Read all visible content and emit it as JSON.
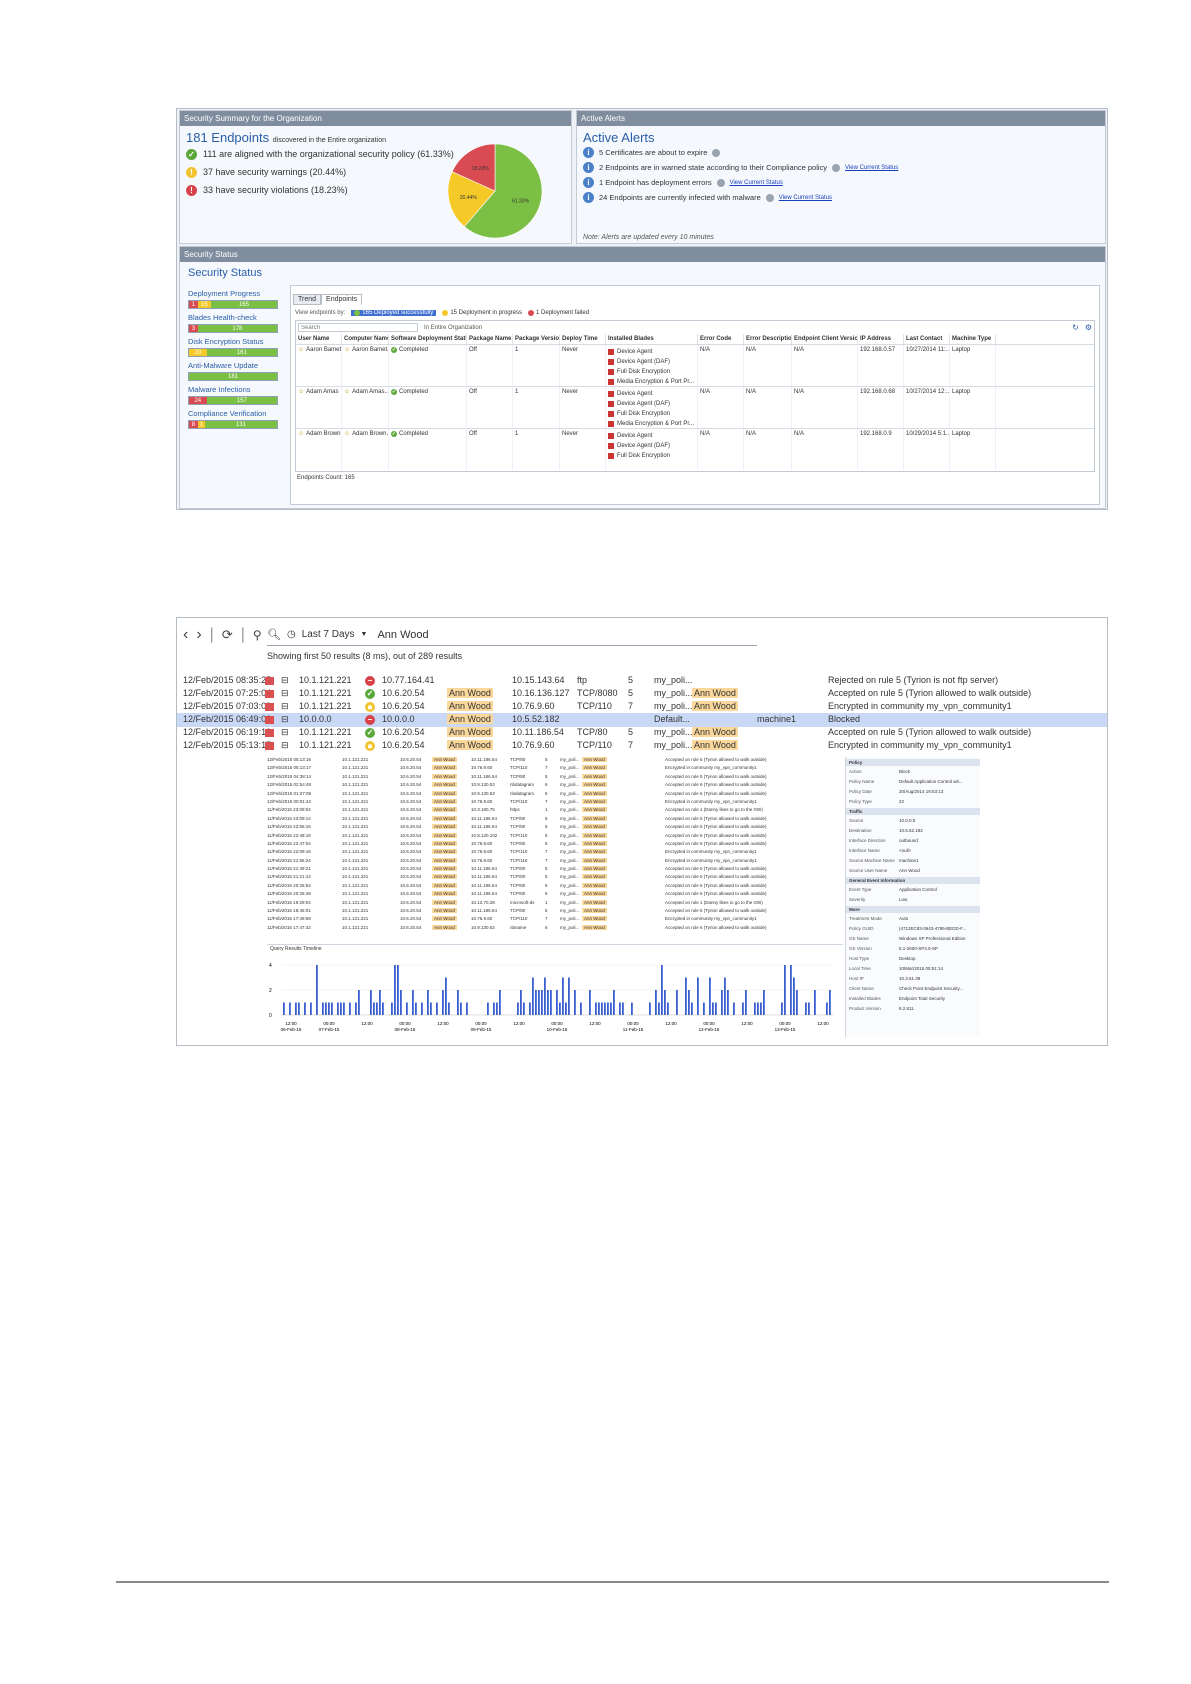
{
  "screenshot1": {
    "summary": {
      "header": "Security Summary for the Organization",
      "endpoints_count": "181 Endpoints",
      "endpoints_suffix": "discovered in the Entire organization",
      "aligned": "111 are aligned with the organizational security policy (61.33%)",
      "warnings": "37 have security warnings (20.44%)",
      "violations": "33 have security violations (18.23%)",
      "colors": {
        "ok": "#5aa83a",
        "warn": "#f2c431",
        "err": "#d9424a"
      }
    },
    "pie_data": {
      "type": "pie",
      "slices": [
        {
          "label": "61.33%",
          "value": 61.33,
          "color": "#7cbf45"
        },
        {
          "label": "20.44%",
          "value": 20.44,
          "color": "#f4c928"
        },
        {
          "label": "18.23%",
          "value": 18.23,
          "color": "#d94b53"
        }
      ]
    },
    "alerts": {
      "header": "Active Alerts",
      "title": "Active Alerts",
      "items": [
        {
          "text": "5 Certificates are about to expire",
          "link": ""
        },
        {
          "text": "2 Endpoints are in warned state according to their Compliance policy",
          "link": "View Current Status"
        },
        {
          "text": "1 Endpoint has deployment errors",
          "link": "View Current Status"
        },
        {
          "text": "24 Endpoints are currently infected with malware",
          "link": "View Current Status"
        }
      ],
      "note": "Note: Alerts are updated every 10 minutes"
    },
    "status": {
      "header": "Security Status",
      "title": "Security Status",
      "sidebar": [
        {
          "label": "Deployment Progress",
          "segments": [
            {
              "v": "1",
              "c": "#d94b53",
              "w": 10
            },
            {
              "v": "15",
              "c": "#f4c928",
              "w": 15
            },
            {
              "v": "165",
              "c": "#7cbf45",
              "w": 75
            }
          ]
        },
        {
          "label": "Blades Health-check",
          "segments": [
            {
              "v": "3",
              "c": "#d94b53",
              "w": 10
            },
            {
              "v": "178",
              "c": "#7cbf45",
              "w": 90
            }
          ]
        },
        {
          "label": "Disk Encryption Status",
          "segments": [
            {
              "v": "20",
              "c": "#f4c928",
              "w": 20
            },
            {
              "v": "161",
              "c": "#7cbf45",
              "w": 80
            }
          ]
        },
        {
          "label": "Anti-Malware Update",
          "segments": [
            {
              "v": "181",
              "c": "#7cbf45",
              "w": 100
            }
          ]
        },
        {
          "label": "Malware Infections",
          "segments": [
            {
              "v": "24",
              "c": "#d94b53",
              "w": 20
            },
            {
              "v": "157",
              "c": "#7cbf45",
              "w": 80
            }
          ]
        },
        {
          "label": "Compliance Verification",
          "segments": [
            {
              "v": "8",
              "c": "#d94b53",
              "w": 10
            },
            {
              "v": "1",
              "c": "#f4c928",
              "w": 8
            },
            {
              "v": "131",
              "c": "#7cbf45",
              "w": 82
            }
          ]
        }
      ],
      "tabs": [
        "Trend",
        "Endpoints"
      ],
      "view_label": "View endpoints by:",
      "filters": [
        {
          "label": "165 Deployed successfully",
          "color": "#7cbf45"
        },
        {
          "label": "15 Deployment in progress",
          "color": "#f4c928"
        },
        {
          "label": "1 Deployment failed",
          "color": "#d94b53"
        }
      ],
      "search_placeholder": "Search",
      "scope": "In Entire Organization",
      "columns": [
        "User Name",
        "Computer Name",
        "Software Deployment Status",
        "Package Name",
        "Package Version",
        "Deploy Time",
        "Installed Blades",
        "Error Code",
        "Error Description",
        "Endpoint Client Version",
        "IP Address",
        "Last Contact",
        "Machine Type"
      ],
      "rows": [
        {
          "user": "Aaron Bamet...",
          "computer": "Aaron Bamet...",
          "status": "Completed",
          "pkg": "Off",
          "ver": "1",
          "time": "Never",
          "blades": [
            "Device Agent",
            "Device Agent (DAF)",
            "Full Disk Encryption",
            "Media Encryption & Port Pr..."
          ],
          "err": "N/A",
          "desc": "N/A",
          "client": "N/A",
          "ip": "192.168.0.57",
          "contact": "10/27/2014 11:...",
          "type": "Laptop"
        },
        {
          "user": "Adam Amas",
          "computer": "Adam Amas...",
          "status": "Completed",
          "pkg": "Off",
          "ver": "1",
          "time": "Never",
          "blades": [
            "Device Agent",
            "Device Agent (DAF)",
            "Full Disk Encryption",
            "Media Encryption & Port Pr..."
          ],
          "err": "N/A",
          "desc": "N/A",
          "client": "N/A",
          "ip": "192.168.0.68",
          "contact": "10/27/2014 12:...",
          "type": "Laptop"
        },
        {
          "user": "Adam Brown",
          "computer": "Adam Brown...",
          "status": "Completed",
          "pkg": "Off",
          "ver": "1",
          "time": "Never",
          "blades": [
            "Device Agent",
            "Device Agent (DAF)",
            "Full Disk Encryption"
          ],
          "err": "N/A",
          "desc": "N/A",
          "client": "N/A",
          "ip": "192.168.0.9",
          "contact": "10/29/2014 5:1...",
          "type": "Laptop"
        }
      ],
      "count": "Endpoints Count: 165"
    }
  },
  "screenshot2": {
    "query": {
      "range": "Last 7 Days",
      "text": "Ann Wood"
    },
    "results_summary": "Showing first 50 results (8 ms), out of 289 results",
    "rows": [
      {
        "time": "12/Feb/2015 08:35:25",
        "src": "10.1.121.221",
        "dst": "10.77.164.41",
        "user": "",
        "dst2": "10.15.143.64",
        "svc": "ftp",
        "rule": "5",
        "policy": "my_poli...",
        "user2": "",
        "machine": "",
        "desc": "Rejected on rule 5 (Tyrion is not ftp server)",
        "action": "err"
      },
      {
        "time": "12/Feb/2015 07:25:04",
        "src": "10.1.121.221",
        "dst": "10.6.20.54",
        "user": "Ann Wood",
        "dst2": "10.16.136.127",
        "svc": "TCP/8080",
        "rule": "5",
        "policy": "my_poli...",
        "user2": "Ann Wood",
        "machine": "",
        "desc": "Accepted on rule 5 (Tyrion allowed to walk outside)",
        "action": "ok"
      },
      {
        "time": "12/Feb/2015 07:03:09",
        "src": "10.1.121.221",
        "dst": "10.6.20.54",
        "user": "Ann Wood",
        "dst2": "10.76.9.60",
        "svc": "TCP/110",
        "rule": "7",
        "policy": "my_poli...",
        "user2": "Ann Wood",
        "machine": "",
        "desc": "Encrypted in community my_vpn_community1",
        "action": "warn"
      },
      {
        "time": "12/Feb/2015 06:49:00",
        "src": "10.0.0.0",
        "dst": "10.0.0.0",
        "user": "Ann Wood",
        "dst2": "10.5.52.182",
        "svc": "",
        "rule": "",
        "policy": "Default...",
        "user2": "",
        "machine": "machine1",
        "desc": "Blocked",
        "action": "err"
      },
      {
        "time": "12/Feb/2015 06:19:16",
        "src": "10.1.121.221",
        "dst": "10.6.20.54",
        "user": "Ann Wood",
        "dst2": "10.11.186.54",
        "svc": "TCP/80",
        "rule": "5",
        "policy": "my_poli...",
        "user2": "Ann Wood",
        "machine": "",
        "desc": "Accepted on rule 5 (Tyrion allowed to walk outside)",
        "action": "ok"
      },
      {
        "time": "12/Feb/2015 05:13:17",
        "src": "10.1.121.221",
        "dst": "10.6.20.54",
        "user": "Ann Wood",
        "dst2": "10.76.9.60",
        "svc": "TCP/110",
        "rule": "7",
        "policy": "my_poli...",
        "user2": "Ann Wood",
        "machine": "",
        "desc": "Encrypted in community my_vpn_community1",
        "action": "warn"
      }
    ],
    "mini_rows": [
      {
        "time": "12/Feb/2015 05:13:16",
        "ip": "10.1.121.221",
        "dst": "10.6.20.54",
        "user": "Ann Wood",
        "dst2": "10.11.186.54",
        "svc": "TCP/80",
        "rule": "5",
        "desc": "Accepted on rule 5 (Tyrion allowed to walk outside)"
      },
      {
        "time": "12/Feb/2015 05:13:17",
        "ip": "10.1.121.221",
        "dst": "10.6.20.54",
        "user": "Ann Wood",
        "dst2": "10.76.9.60",
        "svc": "TCP/110",
        "rule": "7",
        "desc": "Encrypted in community my_vpn_community1"
      },
      {
        "time": "12/Feb/2015 04:38:14",
        "ip": "10.1.121.221",
        "dst": "10.6.20.54",
        "user": "Ann Wood",
        "dst2": "10.11.186.54",
        "svc": "TCP/80",
        "rule": "5",
        "desc": "Accepted on rule 5 (Tyrion allowed to walk outside)"
      },
      {
        "time": "12/Feb/2015 02:54:48",
        "ip": "10.1.121.221",
        "dst": "10.6.20.54",
        "user": "Ann Wood",
        "dst2": "10.9.130.53",
        "svc": "nbdatagram",
        "rule": "6",
        "desc": "Accepted on rule 6 (Tyrion allowed to walk outside)"
      },
      {
        "time": "12/Feb/2015 01:27:08",
        "ip": "10.1.121.221",
        "dst": "10.6.20.54",
        "user": "Ann Wood",
        "dst2": "10.9.130.53",
        "svc": "nbdatagram",
        "rule": "6",
        "desc": "Accepted on rule 6 (Tyrion allowed to walk outside)"
      },
      {
        "time": "12/Feb/2015 00:01:42",
        "ip": "10.1.121.221",
        "dst": "10.6.20.54",
        "user": "Ann Wood",
        "dst2": "10.76.9.60",
        "svc": "TCP/110",
        "rule": "7",
        "desc": "Encrypted in community my_vpn_community1"
      },
      {
        "time": "11/Feb/2015 23:09:04",
        "ip": "10.1.121.221",
        "dst": "10.6.20.54",
        "user": "Ann Wood",
        "dst2": "10.3.190.75",
        "svc": "https",
        "rule": "1",
        "desc": "Accepted on rule 1 (Danny likes to go to the GW)"
      },
      {
        "time": "11/Feb/2015 23:09:14",
        "ip": "10.1.121.221",
        "dst": "10.6.20.54",
        "user": "Ann Wood",
        "dst2": "10.11.186.54",
        "svc": "TCP/80",
        "rule": "5",
        "desc": "Accepted on rule 5 (Tyrion allowed to walk outside)"
      },
      {
        "time": "11/Feb/2015 22:56:16",
        "ip": "10.1.121.221",
        "dst": "10.6.20.54",
        "user": "Ann Wood",
        "dst2": "10.11.186.54",
        "svc": "TCP/80",
        "rule": "5",
        "desc": "Accepted on rule 5 (Tyrion allowed to walk outside)"
      },
      {
        "time": "11/Feb/2015 22:48:18",
        "ip": "10.1.121.221",
        "dst": "10.6.20.54",
        "user": "Ann Wood",
        "dst2": "10.8.120.102",
        "svc": "TCP/110",
        "rule": "6",
        "desc": "Accepted on rule 6 (Tyrion allowed to walk outside)"
      },
      {
        "time": "11/Feb/2015 22:47:04",
        "ip": "10.1.121.221",
        "dst": "10.6.20.54",
        "user": "Ann Wood",
        "dst2": "10.76.9.60",
        "svc": "TCP/80",
        "rule": "5",
        "desc": "Accepted on rule 5 (Tyrion allowed to walk outside)"
      },
      {
        "time": "11/Feb/2015 22:09:16",
        "ip": "10.1.121.221",
        "dst": "10.6.20.54",
        "user": "Ann Wood",
        "dst2": "10.76.9.60",
        "svc": "TCP/110",
        "rule": "7",
        "desc": "Encrypted in community my_vpn_community1"
      },
      {
        "time": "11/Feb/2015 21:56:24",
        "ip": "10.1.121.221",
        "dst": "10.6.20.54",
        "user": "Ann Wood",
        "dst2": "10.76.9.60",
        "svc": "TCP/110",
        "rule": "7",
        "desc": "Encrypted in community my_vpn_community1"
      },
      {
        "time": "11/Feb/2015 21:49:21",
        "ip": "10.1.121.221",
        "dst": "10.6.20.54",
        "user": "Ann Wood",
        "dst2": "10.11.186.54",
        "svc": "TCP/80",
        "rule": "5",
        "desc": "Accepted on rule 5 (Tyrion allowed to walk outside)"
      },
      {
        "time": "11/Feb/2015 21:21:14",
        "ip": "10.1.121.221",
        "dst": "10.6.20.54",
        "user": "Ann Wood",
        "dst2": "10.11.186.54",
        "svc": "TCP/80",
        "rule": "5",
        "desc": "Accepted on rule 5 (Tyrion allowed to walk outside)"
      },
      {
        "time": "11/Feb/2015 20:26:52",
        "ip": "10.1.121.221",
        "dst": "10.6.20.54",
        "user": "Ann Wood",
        "dst2": "10.11.186.54",
        "svc": "TCP/80",
        "rule": "5",
        "desc": "Accepted on rule 5 (Tyrion allowed to walk outside)"
      },
      {
        "time": "11/Feb/2015 20:25:49",
        "ip": "10.1.121.221",
        "dst": "10.6.20.54",
        "user": "Ann Wood",
        "dst2": "10.11.186.54",
        "svc": "TCP/80",
        "rule": "5",
        "desc": "Accepted on rule 5 (Tyrion allowed to walk outside)"
      },
      {
        "time": "11/Feb/2015 19:29:04",
        "ip": "10.1.121.221",
        "dst": "10.6.20.54",
        "user": "Ann Wood",
        "dst2": "10.12.70.28",
        "svc": "microsoft-ds",
        "rule": "1",
        "desc": "Accepted on rule 1 (Danny likes to go to the GW)"
      },
      {
        "time": "11/Feb/2015 18:45:01",
        "ip": "10.1.121.221",
        "dst": "10.6.20.54",
        "user": "Ann Wood",
        "dst2": "10.11.186.54",
        "svc": "TCP/80",
        "rule": "5",
        "desc": "Accepted on rule 5 (Tyrion allowed to walk outside)"
      },
      {
        "time": "11/Feb/2015 17:49:59",
        "ip": "10.1.121.221",
        "dst": "10.6.20.54",
        "user": "Ann Wood",
        "dst2": "10.76.9.60",
        "svc": "TCP/110",
        "rule": "7",
        "desc": "Encrypted in community my_vpn_community1"
      },
      {
        "time": "11/Feb/2015 17:47:42",
        "ip": "10.1.121.221",
        "dst": "10.6.20.54",
        "user": "Ann Wood",
        "dst2": "10.9.130.53",
        "svc": "nbname",
        "rule": "6",
        "desc": "Accepted on rule 6 (Tyrion allowed to walk outside)"
      }
    ],
    "details": {
      "sections": [
        {
          "title": "Policy",
          "rows": [
            [
              "Action",
              "Block"
            ],
            [
              "Policy Name",
              "Default Application Control wit..."
            ],
            [
              "Policy Date",
              "20/Aug/2014 19:53:13"
            ],
            [
              "Policy Type",
              "22"
            ]
          ]
        },
        {
          "title": "Traffic",
          "rows": [
            [
              "Source",
              "10.0.0.0"
            ],
            [
              "Destination",
              "10.5.52.182"
            ],
            [
              "Interface Direction",
              "outbound"
            ],
            [
              "Interface Name",
              "<null>"
            ],
            [
              "Source Machine Name",
              "machine1"
            ],
            [
              "Source User Name",
              "Ann Wood"
            ]
          ]
        },
        {
          "title": "General Event Information",
          "rows": [
            [
              "Event Type",
              "Application Control"
            ],
            [
              "Severity",
              "Low"
            ]
          ]
        },
        {
          "title": "More",
          "rows": [
            [
              "Treatment Mode",
              "Auto"
            ],
            [
              "Policy GUID",
              "{4712EC83-0643-4795-BEDD-F..."
            ],
            [
              "OS Name",
              "Windows XP Professional Edition"
            ],
            [
              "OS Version",
              "5.1-2600-SP3.0-SP"
            ],
            [
              "Host Type",
              "Desktop"
            ],
            [
              "Local Time",
              "10/Mar/2015 05:51:14"
            ],
            [
              "Host IP",
              "10.3.51.39"
            ],
            [
              "Client Name",
              "Check Point Endpoint Security..."
            ],
            [
              "Installed Blades",
              "Endpoint Total Security"
            ],
            [
              "Product Version",
              "8.2.811"
            ]
          ]
        }
      ]
    },
    "timeline": {
      "title": "Query Results Timeline",
      "y_ticks": [
        "4",
        "2",
        "0"
      ],
      "x_labels": [
        "12:00\n06-Feb-15",
        "00:00\n07-Feb-15",
        "12:00",
        "00:00\n08-Feb-15",
        "12:00",
        "00:00\n09-Feb-15",
        "12:00",
        "00:00\n10-Feb-15",
        "12:00",
        "00:00\n11-Feb-15",
        "12:00",
        "00:00\n12-Feb-15",
        "12:00",
        "00:00\n13-Feb-15",
        "12:00"
      ]
    }
  }
}
